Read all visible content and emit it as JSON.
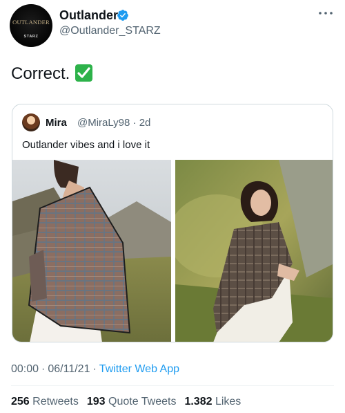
{
  "author": {
    "display_name": "Outlander",
    "handle": "@Outlander_STARZ",
    "avatar_logo_text": "OUTLANDER",
    "avatar_logo_subtext": "STARZ",
    "verified_icon": "verified-badge-icon"
  },
  "tweet": {
    "text": "Correct.",
    "emoji_icon": "check-mark-button-emoji"
  },
  "quoted_tweet": {
    "display_name": "Mira",
    "handle": "@MiraLy98",
    "separator": "·",
    "time_ago": "2d",
    "text": "Outlander vibes and i love it"
  },
  "meta": {
    "time": "00:00",
    "separator": "·",
    "date": "06/11/21",
    "source": "Twitter Web App"
  },
  "stats": {
    "retweets_count": "256",
    "retweets_label": "Retweets",
    "quote_tweets_count": "193",
    "quote_tweets_label": "Quote Tweets",
    "likes_count": "1.382",
    "likes_label": "Likes"
  },
  "colors": {
    "link_blue": "#1d9bf0",
    "verified_blue": "#1d9bf0",
    "secondary_text": "#536471",
    "check_green": "#2db24a"
  }
}
